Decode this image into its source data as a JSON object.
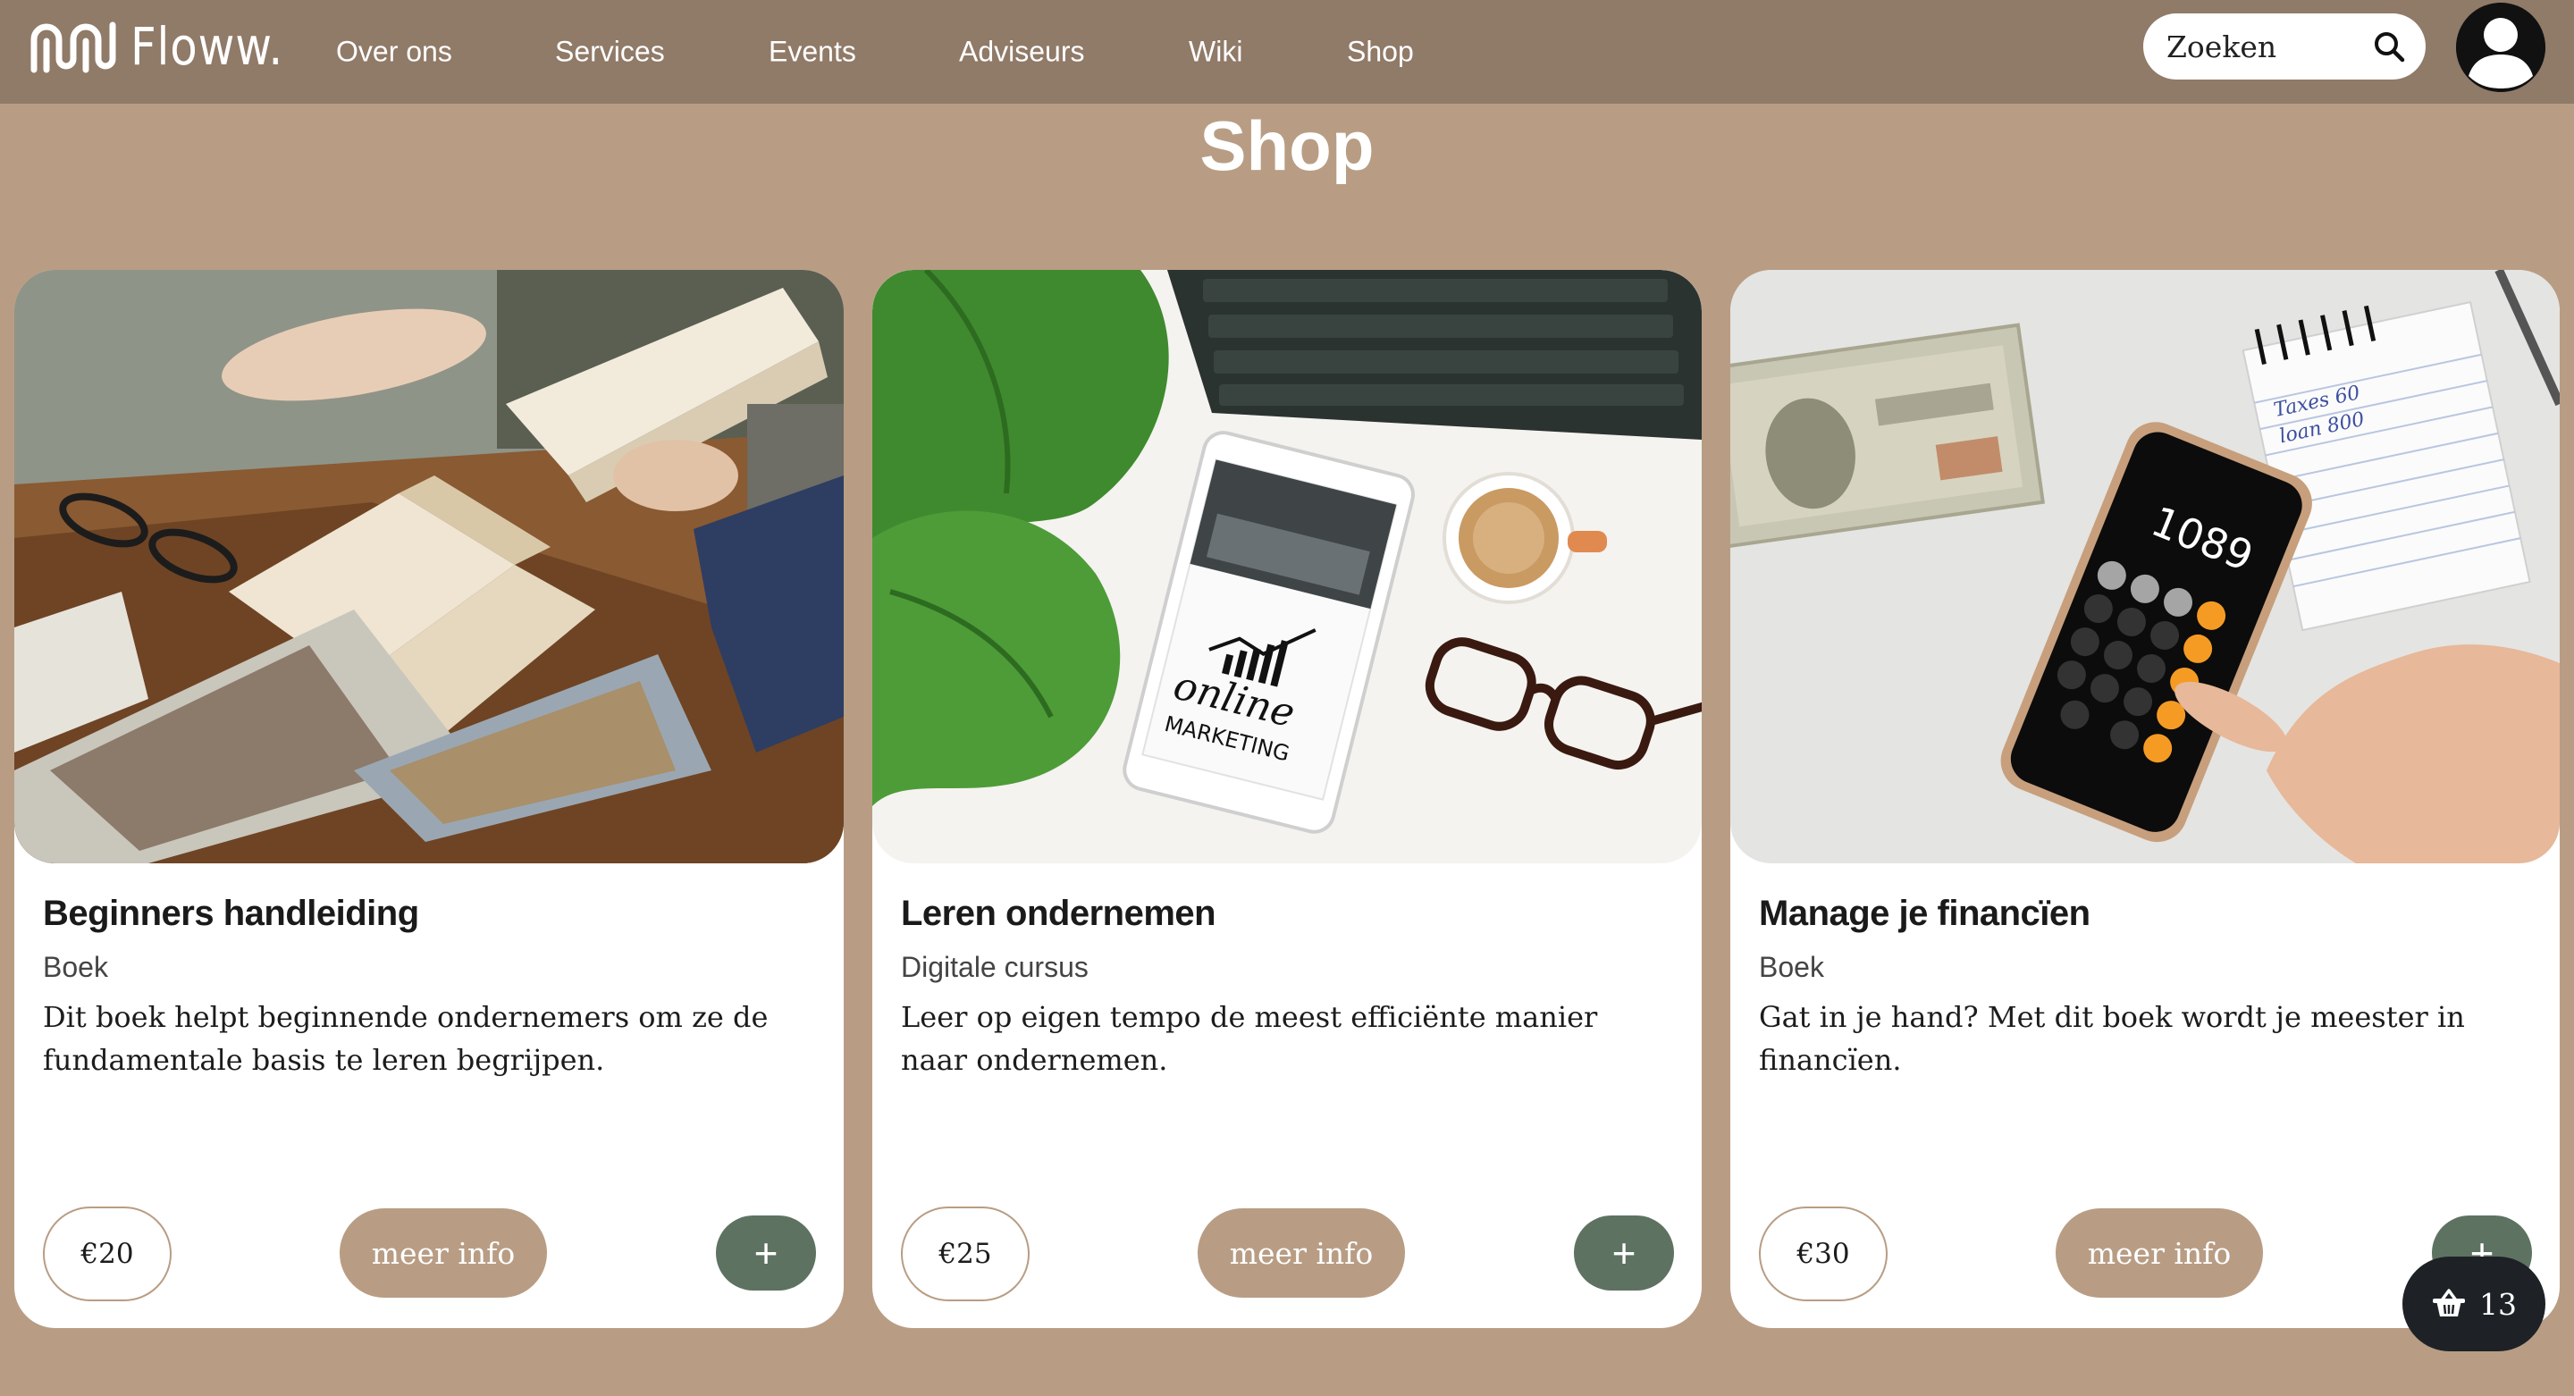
{
  "brand": {
    "name": "Floww."
  },
  "nav": {
    "links": [
      {
        "label": "Over ons"
      },
      {
        "label": "Services"
      },
      {
        "label": "Events"
      },
      {
        "label": "Adviseurs"
      },
      {
        "label": "Wiki"
      },
      {
        "label": "Shop"
      }
    ]
  },
  "search": {
    "placeholder": "Zoeken",
    "icon": "search-icon"
  },
  "user": {
    "icon": "user-avatar-icon"
  },
  "page": {
    "title": "Shop"
  },
  "products": [
    {
      "title": "Beginners handleiding",
      "category": "Boek",
      "description": "Dit boek helpt beginnende ondernemers om ze de fundamentale basis te leren begrijpen.",
      "price": "€20",
      "info_label": "meer info",
      "add_label": "+",
      "image": "books-photo"
    },
    {
      "title": "Leren ondernemen",
      "category": "Digitale cursus",
      "description": "Leer op eigen tempo de meest efficiënte manier naar ondernemen.",
      "price": "€25",
      "info_label": "meer info",
      "add_label": "+",
      "image": "online-marketing-tablet-photo"
    },
    {
      "title": "Manage je financïen",
      "category": "Boek",
      "description": "Gat in je hand? Met dit boek wordt je meester in financïen.",
      "price": "€30",
      "info_label": "meer info",
      "add_label": "+",
      "image": "calculator-money-photo"
    }
  ],
  "cart": {
    "count": "13",
    "icon": "basket-icon"
  },
  "image_text": {
    "tablet_line1": "online",
    "tablet_line2": "MARKETING",
    "phone_display": "1089",
    "notepad_line1": "Taxes 60",
    "notepad_line2": "loan 800"
  },
  "colors": {
    "page_bg": "#b89d84",
    "navbar_bg": "#907a68",
    "accent_tan": "#b89d84",
    "add_button": "#5e7262",
    "cart_bg": "#1e2226"
  }
}
